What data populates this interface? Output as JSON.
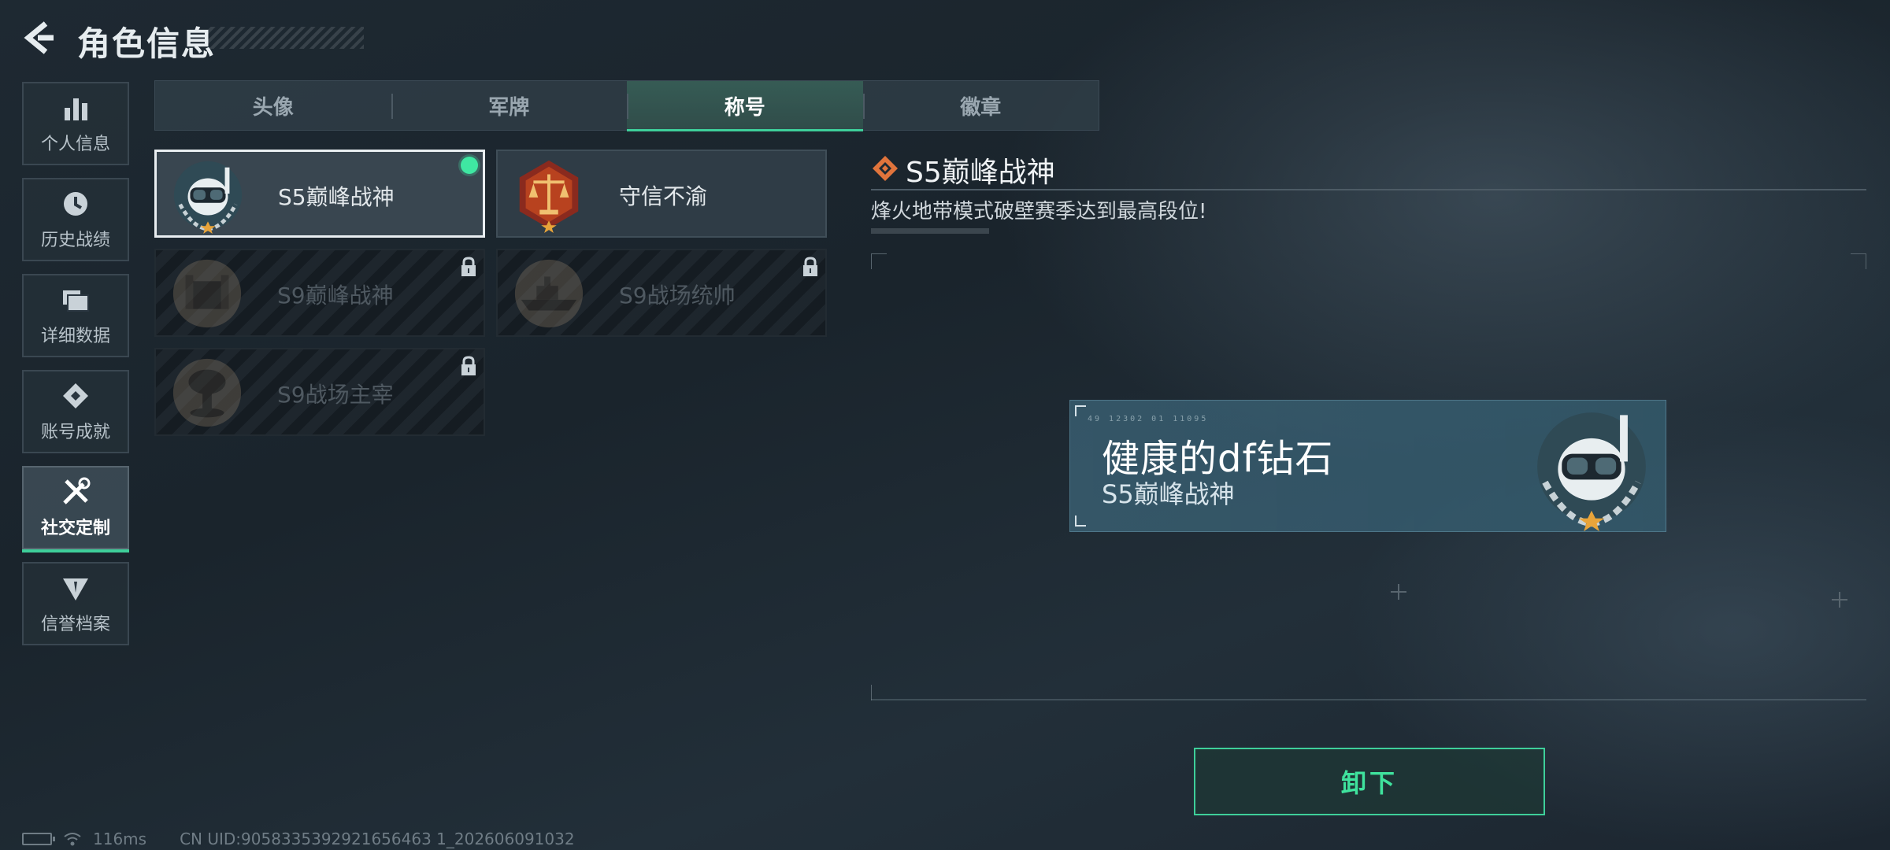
{
  "header": {
    "title": "角色信息"
  },
  "sidebar": {
    "items": [
      {
        "label": "个人信息",
        "icon": "bar-chart-icon",
        "active": false
      },
      {
        "label": "历史战绩",
        "icon": "clock-icon",
        "active": false
      },
      {
        "label": "详细数据",
        "icon": "folder-icon",
        "active": false
      },
      {
        "label": "账号成就",
        "icon": "achievement-icon",
        "active": false
      },
      {
        "label": "社交定制",
        "icon": "tools-icon",
        "active": true
      },
      {
        "label": "信誉档案",
        "icon": "shield-icon",
        "active": false
      }
    ]
  },
  "tabs": [
    {
      "label": "头像",
      "active": false
    },
    {
      "label": "军牌",
      "active": false
    },
    {
      "label": "称号",
      "active": true
    },
    {
      "label": "徽章",
      "active": false
    }
  ],
  "titles": [
    {
      "name": "S5巅峰战神",
      "state": "equipped",
      "emblem": "diver-skull-emblem"
    },
    {
      "name": "守信不渝",
      "state": "owned",
      "emblem": "scales-emblem"
    },
    {
      "name": "S9巅峰战神",
      "state": "locked",
      "emblem": "fortress-emblem"
    },
    {
      "name": "S9战场统帅",
      "state": "locked",
      "emblem": "warship-emblem"
    },
    {
      "name": "S9战场主宰",
      "state": "locked",
      "emblem": "mushroom-cloud-emblem"
    }
  ],
  "detail": {
    "title": "S5巅峰战神",
    "description": "烽火地带模式破壁赛季达到最高段位!",
    "plate": {
      "player_name": "健康的df钻石",
      "title": "S5巅峰战神",
      "code": "49 12302 01 11095"
    }
  },
  "actions": {
    "unequip_label": "卸下"
  },
  "status": {
    "ping": "116ms",
    "uid": "CN UID:9058335392921656463 1_202606091032"
  },
  "colors": {
    "accent": "#3ecf9a",
    "equipped_dot": "#3fe7a2",
    "diamond": "#e0743c"
  }
}
